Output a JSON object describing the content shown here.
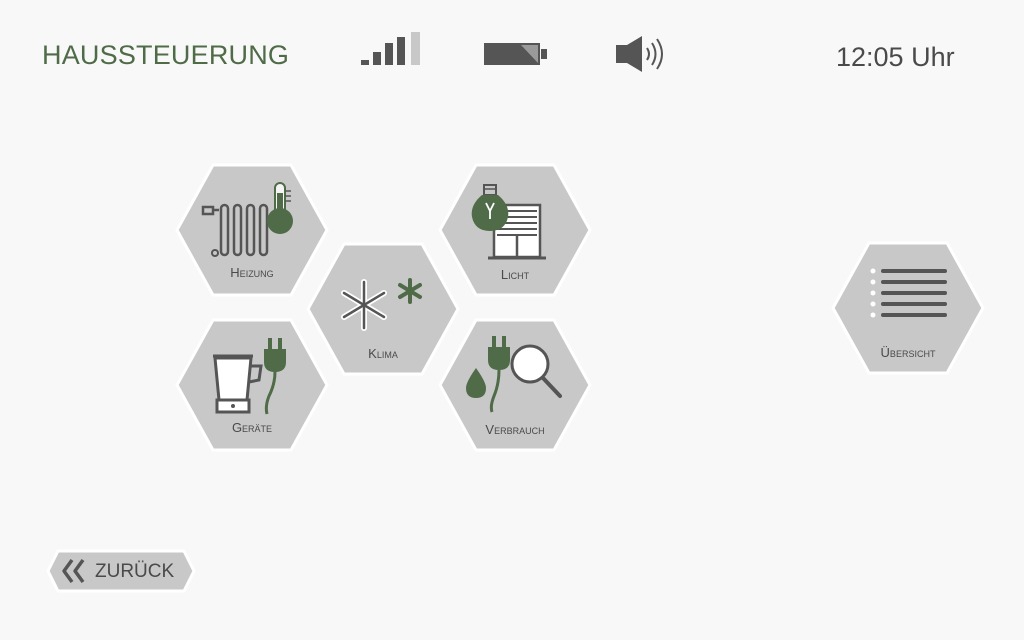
{
  "header": {
    "title": "HAUSSTEUERUNG",
    "time": "12:05 Uhr",
    "signal_icon": "signal-strength-icon",
    "signal_level": 0.75,
    "battery_icon": "battery-icon",
    "volume_icon": "speaker-volume-icon"
  },
  "tiles": {
    "heizung": {
      "label": "Heizung",
      "icon": "radiator-thermometer-icon"
    },
    "klima": {
      "label": "Klima",
      "icon": "snowflake-icon"
    },
    "licht": {
      "label": "Licht",
      "icon": "bulb-shutter-icon"
    },
    "geraete": {
      "label": "Geräte",
      "icon": "blender-plug-icon"
    },
    "verbrauch": {
      "label": "Verbrauch",
      "icon": "consumption-magnifier-icon"
    },
    "uebersicht": {
      "label": "Übersicht",
      "icon": "list-icon"
    }
  },
  "footer": {
    "back_label": "ZURÜCK",
    "back_icon": "double-chevron-left-icon"
  },
  "colors": {
    "accent_green": "#4f6b48",
    "tile_fill": "#c8c8c8",
    "tile_border": "#ffffff",
    "icon_dark": "#555555",
    "background": "#f8f8f8"
  }
}
